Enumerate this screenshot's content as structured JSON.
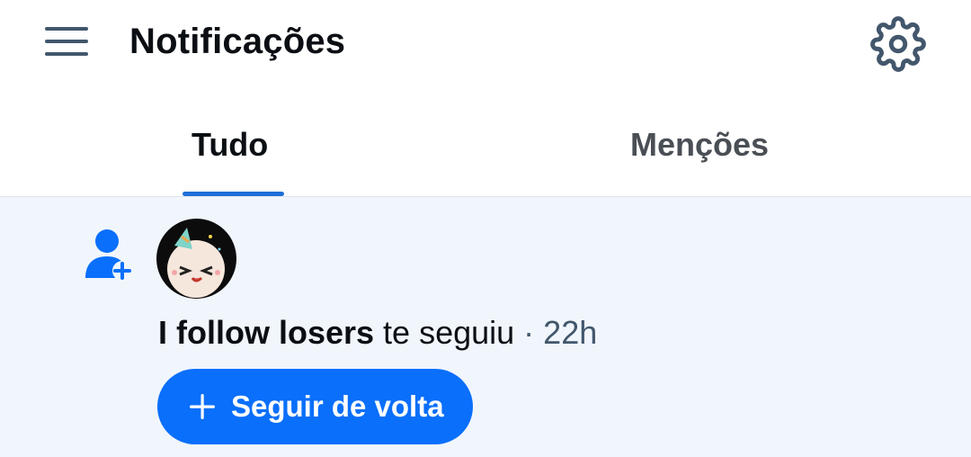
{
  "header": {
    "menu_icon": "hamburger-menu-icon",
    "title": "Notificações",
    "settings_icon": "gear-icon"
  },
  "tabs": [
    {
      "label": "Tudo",
      "selected": true
    },
    {
      "label": "Menções",
      "selected": false
    }
  ],
  "notification": {
    "type_icon": "person-add-icon",
    "user_name": "I follow losers",
    "action_text": " te seguiu",
    "separator": " · ",
    "time_ago": "22h",
    "button_label": "Seguir de volta",
    "button_icon": "plus-icon"
  },
  "colors": {
    "accent": "#0a6ffb",
    "tab_indicator": "#1e6fd9",
    "notification_bg": "#f1f6fd",
    "icon_gray": "#42576c"
  }
}
